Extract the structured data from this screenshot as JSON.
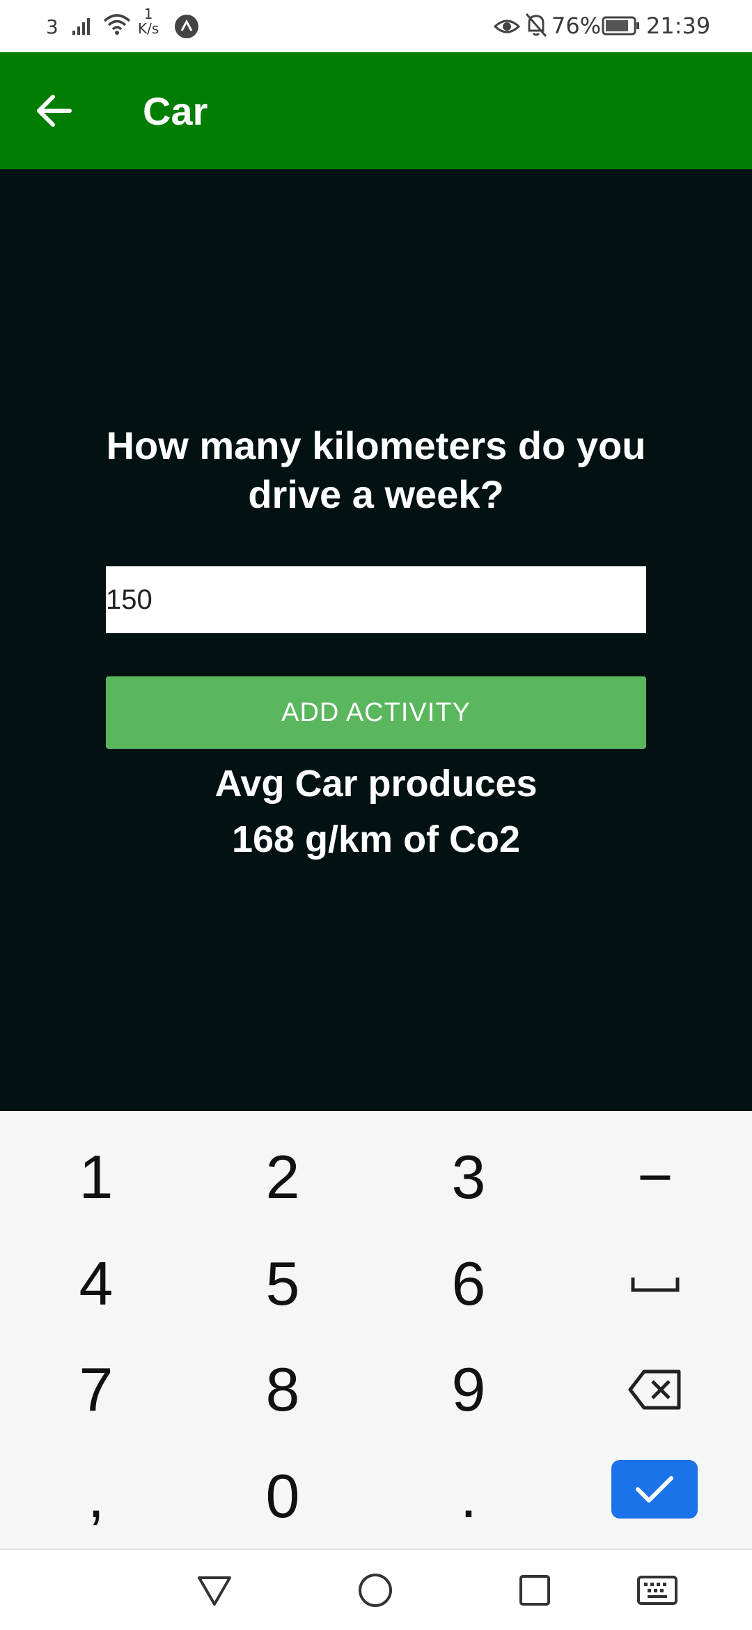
{
  "status_bar": {
    "carrier": "3",
    "net_speed_value": "1",
    "net_speed_unit": "K/s",
    "battery_percent": "76%",
    "time": "21:39"
  },
  "app_bar": {
    "title": "Car",
    "back_icon": "arrow-back-icon"
  },
  "content": {
    "question": "How many kilometers do you drive a week?",
    "km_input_value": "150",
    "add_button_label": "ADD ACTIVITY",
    "info_line1": "Avg Car produces",
    "info_line2": "168 g/km of Co2"
  },
  "keyboard": {
    "rows": [
      [
        "1",
        "2",
        "3",
        "−"
      ],
      [
        "4",
        "5",
        "6",
        "space"
      ],
      [
        "7",
        "8",
        "9",
        "backspace"
      ],
      [
        ",",
        "0",
        ".",
        "done"
      ]
    ],
    "k1": "1",
    "k2": "2",
    "k3": "3",
    "kminus": "−",
    "k4": "4",
    "k5": "5",
    "k6": "6",
    "k7": "7",
    "k8": "8",
    "k9": "9",
    "kcomma": ",",
    "k0": "0",
    "kdot": "."
  },
  "colors": {
    "app_bar": "#017d01",
    "background": "#021213",
    "button": "#5bb75e",
    "done_key": "#1a73e8"
  }
}
